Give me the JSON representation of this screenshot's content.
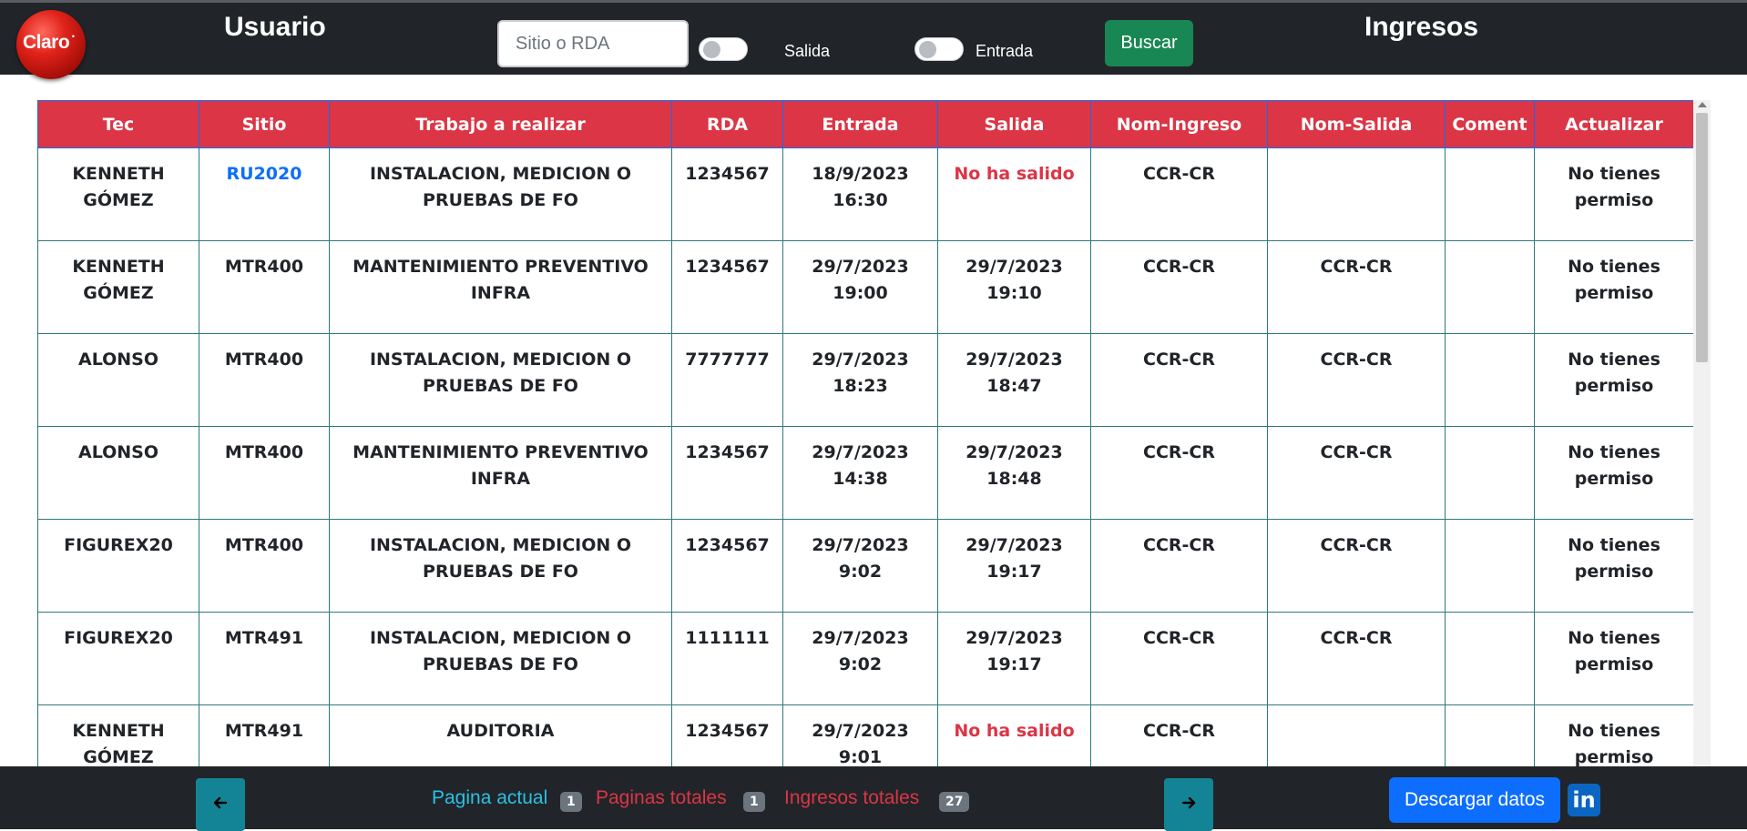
{
  "header": {
    "logo_text": "Claro",
    "usuario_title": "Usuario",
    "ingresos_title": "Ingresos",
    "search_placeholder": "Sitio o RDA",
    "salida_label": "Salida",
    "entrada_label": "Entrada",
    "buscar_label": "Buscar"
  },
  "table": {
    "columns": [
      "Tec",
      "Sitio",
      "Trabajo a realizar",
      "RDA",
      "Entrada",
      "Salida",
      "Nom-Ingreso",
      "Nom-Salida",
      "Coment",
      "Actualizar"
    ],
    "rows": [
      {
        "tec": "KENNETH GÓMEZ",
        "sitio": "RU2020",
        "trabajo": "INSTALACION, MEDICION O PRUEBAS DE FO",
        "rda": "1234567",
        "entrada": "18/9/2023 16:30",
        "salida": "No ha salido",
        "nom_ingreso": "CCR-CR",
        "nom_salida": "",
        "coment": "",
        "actualizar": "No tienes permiso"
      },
      {
        "tec": "KENNETH GÓMEZ",
        "sitio": "MTR400",
        "trabajo": "MANTENIMIENTO PREVENTIVO INFRA",
        "rda": "1234567",
        "entrada": "29/7/2023 19:00",
        "salida": "29/7/2023 19:10",
        "nom_ingreso": "CCR-CR",
        "nom_salida": "CCR-CR",
        "coment": "",
        "actualizar": "No tienes permiso"
      },
      {
        "tec": "ALONSO",
        "sitio": "MTR400",
        "trabajo": "INSTALACION, MEDICION O PRUEBAS DE FO",
        "rda": "7777777",
        "entrada": "29/7/2023 18:23",
        "salida": "29/7/2023 18:47",
        "nom_ingreso": "CCR-CR",
        "nom_salida": "CCR-CR",
        "coment": "",
        "actualizar": "No tienes permiso"
      },
      {
        "tec": "ALONSO",
        "sitio": "MTR400",
        "trabajo": "MANTENIMIENTO PREVENTIVO INFRA",
        "rda": "1234567",
        "entrada": "29/7/2023 14:38",
        "salida": "29/7/2023 18:48",
        "nom_ingreso": "CCR-CR",
        "nom_salida": "CCR-CR",
        "coment": "",
        "actualizar": "No tienes permiso"
      },
      {
        "tec": "FIGUREX20",
        "sitio": "MTR400",
        "trabajo": "INSTALACION, MEDICION O PRUEBAS DE FO",
        "rda": "1234567",
        "entrada": "29/7/2023 9:02",
        "salida": "29/7/2023 19:17",
        "nom_ingreso": "CCR-CR",
        "nom_salida": "CCR-CR",
        "coment": "",
        "actualizar": "No tienes permiso"
      },
      {
        "tec": "FIGUREX20",
        "sitio": "MTR491",
        "trabajo": "INSTALACION, MEDICION O PRUEBAS DE FO",
        "rda": "1111111",
        "entrada": "29/7/2023 9:02",
        "salida": "29/7/2023 19:17",
        "nom_ingreso": "CCR-CR",
        "nom_salida": "CCR-CR",
        "coment": "",
        "actualizar": "No tienes permiso"
      },
      {
        "tec": "KENNETH GÓMEZ",
        "sitio": "MTR491",
        "trabajo": "AUDITORIA",
        "rda": "1234567",
        "entrada": "29/7/2023 9:01",
        "salida": "No ha salido",
        "nom_ingreso": "CCR-CR",
        "nom_salida": "",
        "coment": "",
        "actualizar": "No tienes permiso"
      }
    ]
  },
  "footer": {
    "pagina_actual_label": "Pagina actual",
    "pagina_actual": "1",
    "paginas_totales_label": "Paginas totales",
    "paginas_totales": "1",
    "ingresos_totales_label": "Ingresos totales",
    "ingresos_totales": "27",
    "descargar_label": "Descargar datos",
    "linkedin_text": "in"
  },
  "colors": {
    "topbar": "#212529",
    "header_red": "#dc3545",
    "link_blue": "#0d6efd",
    "success_green": "#198754",
    "info_teal": "#138496"
  },
  "icons": {
    "prev": "arrow-left-icon",
    "next": "arrow-right-icon",
    "linkedin": "linkedin-icon"
  }
}
